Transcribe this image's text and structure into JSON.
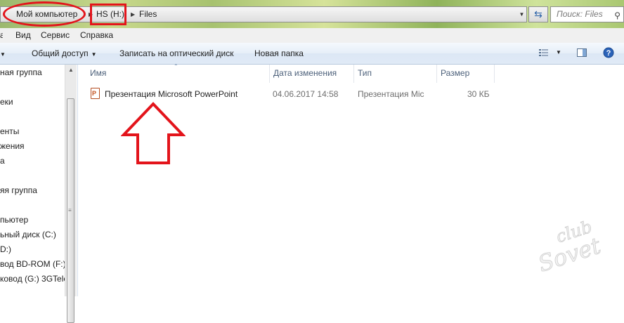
{
  "address_bar": {
    "crumbs": [
      "Мой компьютер",
      "HS (H:)",
      "Files"
    ],
    "search_placeholder": "Поиск: Files"
  },
  "menu": {
    "items": [
      "Вид",
      "Сервис",
      "Справка"
    ]
  },
  "toolbar": {
    "share": "Общий доступ",
    "burn": "Записать на оптический диск",
    "new_folder": "Новая папка"
  },
  "nav": {
    "items": [
      "ная группа",
      "еки",
      "енты",
      "жения",
      "а",
      "яя группа",
      "пьютер",
      "ьный диск (C:)",
      "D:)",
      "вод BD-ROM (F:) N",
      "ковод (G:) 3GTele"
    ]
  },
  "columns": {
    "name": "Имя",
    "date": "Дата изменения",
    "type": "Тип",
    "size": "Размер"
  },
  "files": [
    {
      "name": "Презентация Microsoft PowerPoint",
      "date": "04.06.2017 14:58",
      "type": "Презентация Mic",
      "size": "30 КБ",
      "icon": "powerpoint-icon"
    }
  ],
  "annotations": {
    "color": "#e3141b"
  },
  "watermark": {
    "line1": "club",
    "line2": "Sovet"
  }
}
